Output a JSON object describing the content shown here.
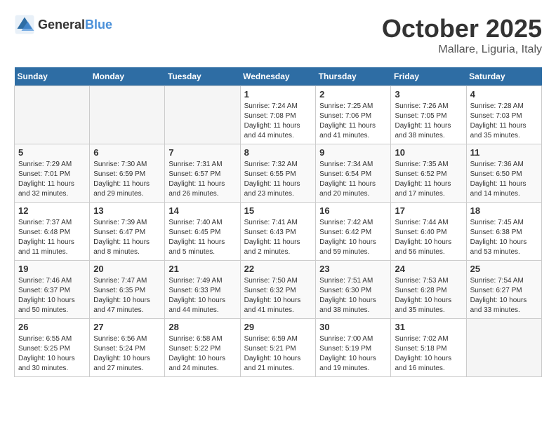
{
  "header": {
    "logo_general": "General",
    "logo_blue": "Blue",
    "month": "October 2025",
    "location": "Mallare, Liguria, Italy"
  },
  "days_of_week": [
    "Sunday",
    "Monday",
    "Tuesday",
    "Wednesday",
    "Thursday",
    "Friday",
    "Saturday"
  ],
  "weeks": [
    [
      {
        "day": "",
        "info": ""
      },
      {
        "day": "",
        "info": ""
      },
      {
        "day": "",
        "info": ""
      },
      {
        "day": "1",
        "info": "Sunrise: 7:24 AM\nSunset: 7:08 PM\nDaylight: 11 hours and 44 minutes."
      },
      {
        "day": "2",
        "info": "Sunrise: 7:25 AM\nSunset: 7:06 PM\nDaylight: 11 hours and 41 minutes."
      },
      {
        "day": "3",
        "info": "Sunrise: 7:26 AM\nSunset: 7:05 PM\nDaylight: 11 hours and 38 minutes."
      },
      {
        "day": "4",
        "info": "Sunrise: 7:28 AM\nSunset: 7:03 PM\nDaylight: 11 hours and 35 minutes."
      }
    ],
    [
      {
        "day": "5",
        "info": "Sunrise: 7:29 AM\nSunset: 7:01 PM\nDaylight: 11 hours and 32 minutes."
      },
      {
        "day": "6",
        "info": "Sunrise: 7:30 AM\nSunset: 6:59 PM\nDaylight: 11 hours and 29 minutes."
      },
      {
        "day": "7",
        "info": "Sunrise: 7:31 AM\nSunset: 6:57 PM\nDaylight: 11 hours and 26 minutes."
      },
      {
        "day": "8",
        "info": "Sunrise: 7:32 AM\nSunset: 6:55 PM\nDaylight: 11 hours and 23 minutes."
      },
      {
        "day": "9",
        "info": "Sunrise: 7:34 AM\nSunset: 6:54 PM\nDaylight: 11 hours and 20 minutes."
      },
      {
        "day": "10",
        "info": "Sunrise: 7:35 AM\nSunset: 6:52 PM\nDaylight: 11 hours and 17 minutes."
      },
      {
        "day": "11",
        "info": "Sunrise: 7:36 AM\nSunset: 6:50 PM\nDaylight: 11 hours and 14 minutes."
      }
    ],
    [
      {
        "day": "12",
        "info": "Sunrise: 7:37 AM\nSunset: 6:48 PM\nDaylight: 11 hours and 11 minutes."
      },
      {
        "day": "13",
        "info": "Sunrise: 7:39 AM\nSunset: 6:47 PM\nDaylight: 11 hours and 8 minutes."
      },
      {
        "day": "14",
        "info": "Sunrise: 7:40 AM\nSunset: 6:45 PM\nDaylight: 11 hours and 5 minutes."
      },
      {
        "day": "15",
        "info": "Sunrise: 7:41 AM\nSunset: 6:43 PM\nDaylight: 11 hours and 2 minutes."
      },
      {
        "day": "16",
        "info": "Sunrise: 7:42 AM\nSunset: 6:42 PM\nDaylight: 10 hours and 59 minutes."
      },
      {
        "day": "17",
        "info": "Sunrise: 7:44 AM\nSunset: 6:40 PM\nDaylight: 10 hours and 56 minutes."
      },
      {
        "day": "18",
        "info": "Sunrise: 7:45 AM\nSunset: 6:38 PM\nDaylight: 10 hours and 53 minutes."
      }
    ],
    [
      {
        "day": "19",
        "info": "Sunrise: 7:46 AM\nSunset: 6:37 PM\nDaylight: 10 hours and 50 minutes."
      },
      {
        "day": "20",
        "info": "Sunrise: 7:47 AM\nSunset: 6:35 PM\nDaylight: 10 hours and 47 minutes."
      },
      {
        "day": "21",
        "info": "Sunrise: 7:49 AM\nSunset: 6:33 PM\nDaylight: 10 hours and 44 minutes."
      },
      {
        "day": "22",
        "info": "Sunrise: 7:50 AM\nSunset: 6:32 PM\nDaylight: 10 hours and 41 minutes."
      },
      {
        "day": "23",
        "info": "Sunrise: 7:51 AM\nSunset: 6:30 PM\nDaylight: 10 hours and 38 minutes."
      },
      {
        "day": "24",
        "info": "Sunrise: 7:53 AM\nSunset: 6:28 PM\nDaylight: 10 hours and 35 minutes."
      },
      {
        "day": "25",
        "info": "Sunrise: 7:54 AM\nSunset: 6:27 PM\nDaylight: 10 hours and 33 minutes."
      }
    ],
    [
      {
        "day": "26",
        "info": "Sunrise: 6:55 AM\nSunset: 5:25 PM\nDaylight: 10 hours and 30 minutes."
      },
      {
        "day": "27",
        "info": "Sunrise: 6:56 AM\nSunset: 5:24 PM\nDaylight: 10 hours and 27 minutes."
      },
      {
        "day": "28",
        "info": "Sunrise: 6:58 AM\nSunset: 5:22 PM\nDaylight: 10 hours and 24 minutes."
      },
      {
        "day": "29",
        "info": "Sunrise: 6:59 AM\nSunset: 5:21 PM\nDaylight: 10 hours and 21 minutes."
      },
      {
        "day": "30",
        "info": "Sunrise: 7:00 AM\nSunset: 5:19 PM\nDaylight: 10 hours and 19 minutes."
      },
      {
        "day": "31",
        "info": "Sunrise: 7:02 AM\nSunset: 5:18 PM\nDaylight: 10 hours and 16 minutes."
      },
      {
        "day": "",
        "info": ""
      }
    ]
  ]
}
